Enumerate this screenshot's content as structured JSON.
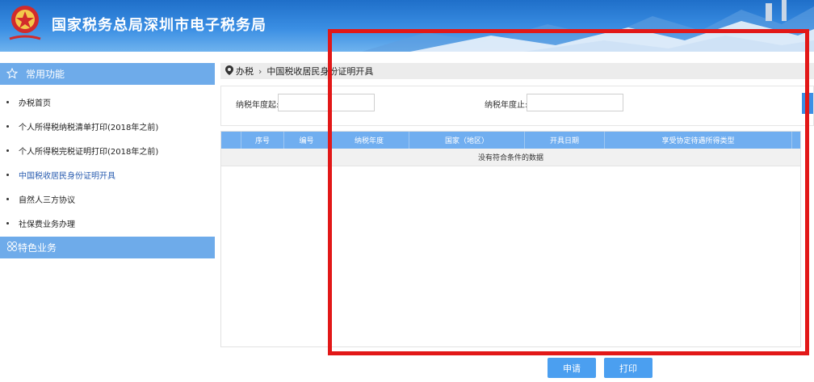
{
  "header": {
    "title": "国家税务总局深圳市电子税务局",
    "emblem_text": "中国税务"
  },
  "sidebar": {
    "section1_label": "常用功能",
    "items": [
      {
        "label": "办税首页"
      },
      {
        "label": "个人所得税纳税清单打印(2018年之前)"
      },
      {
        "label": "个人所得税完税证明打印(2018年之前)"
      },
      {
        "label": "中国税收居民身份证明开具"
      },
      {
        "label": "自然人三方协议"
      },
      {
        "label": "社保费业务办理"
      }
    ],
    "section2_label": "特色业务"
  },
  "breadcrumb": {
    "root": "办税",
    "separator": "›",
    "current": "中国税收居民身份证明开具"
  },
  "filter": {
    "start_label": "纳税年度起:",
    "start_value": "",
    "end_label": "纳税年度止:",
    "end_value": ""
  },
  "grid": {
    "columns": [
      "",
      "序号",
      "编号",
      "纳税年度",
      "国家（地区）",
      "开具日期",
      "享受协定待遇所得类型"
    ],
    "empty_message": "没有符合条件的数据"
  },
  "buttons": {
    "apply": "申请",
    "print": "打印"
  },
  "colors": {
    "accent": "#6eabea",
    "header": "#1f6fc9",
    "highlight_frame": "#e21818"
  }
}
